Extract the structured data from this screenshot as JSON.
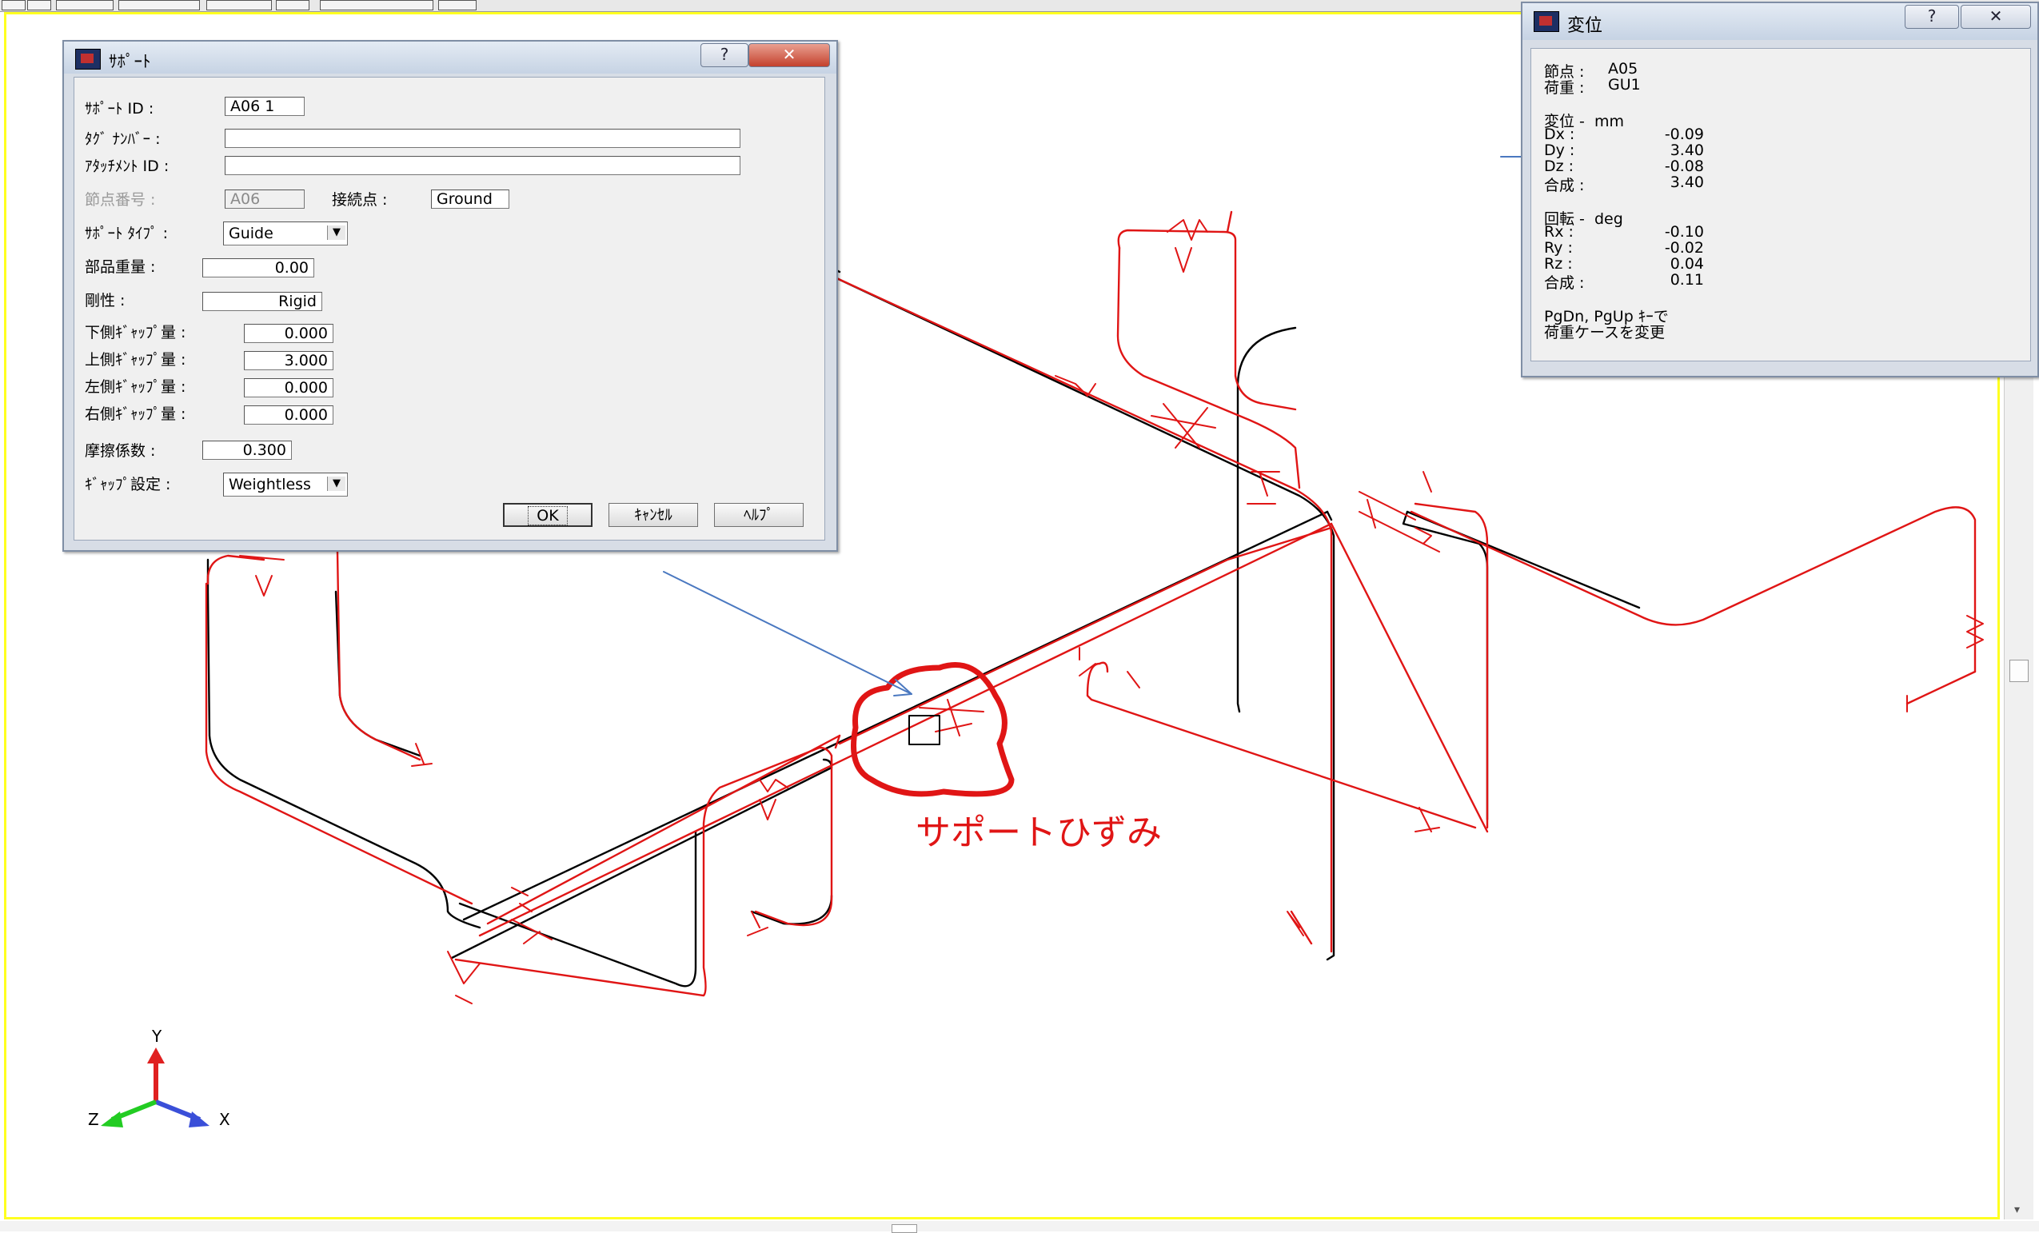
{
  "support_dialog": {
    "title": "ｻﾎﾟｰﾄ",
    "help_glyph": "?",
    "close_glyph": "✕",
    "support_id_label": "ｻﾎﾟｰﾄ ID :",
    "support_id_value": "A06  1",
    "tag_number_label": "ﾀｸﾞ ﾅﾝﾊﾞｰ :",
    "tag_number_value": "",
    "attachment_id_label": "ｱﾀｯﾁﾒﾝﾄ ID :",
    "attachment_id_value": "",
    "node_number_label": "節点番号 :",
    "node_number_value": "A06",
    "connection_point_label": "接続点 :",
    "connection_point_value": "Ground",
    "support_type_label": "ｻﾎﾟｰﾄ ﾀｲﾌﾟ :",
    "support_type_value": "Guide",
    "component_weight_label": "部品重量 :",
    "component_weight_value": "0.00",
    "stiffness_label": "剛性 :",
    "stiffness_value": "Rigid",
    "lower_gap_label": "下側ｷﾞｬｯﾌﾟ量 :",
    "lower_gap_value": "0.000",
    "upper_gap_label": "上側ｷﾞｬｯﾌﾟ量 :",
    "upper_gap_value": "3.000",
    "left_gap_label": "左側ｷﾞｬｯﾌﾟ量 :",
    "left_gap_value": "0.000",
    "right_gap_label": "右側ｷﾞｬｯﾌﾟ量 :",
    "right_gap_value": "0.000",
    "friction_label": "摩擦係数 :",
    "friction_value": "0.300",
    "gap_setting_label": "ｷﾞｬｯﾌﾟ設定 :",
    "gap_setting_value": "Weightless",
    "ok_label": "OK",
    "cancel_label": "ｷｬﾝｾﾙ",
    "help_label": "ﾍﾙﾌﾟ"
  },
  "displacement_window": {
    "title": "変位",
    "help_glyph": "?",
    "close_glyph": "✕",
    "node_label": "節点 :",
    "node_value": "A05",
    "load_label": "荷重 :",
    "load_value": "GU1",
    "displacement_header": "変位 -  mm",
    "dx_label": "Dx :",
    "dx_value": "-0.09",
    "dy_label": "Dy :",
    "dy_value": "3.40",
    "dz_label": "Dz :",
    "dz_value": "-0.08",
    "disp_total_label": "合成 :",
    "disp_total_value": "3.40",
    "rotation_header": "回転 -  deg",
    "rx_label": "Rx :",
    "rx_value": "-0.10",
    "ry_label": "Ry :",
    "ry_value": "-0.02",
    "rz_label": "Rz :",
    "rz_value": "0.04",
    "rot_total_label": "合成 :",
    "rot_total_value": "0.11",
    "hint_line1": "PgDn, PgUp ｷｰで",
    "hint_line2": "荷重ケースを変更"
  },
  "annotation_text": "サポートひずみ",
  "axes": {
    "x": "X",
    "y": "Y",
    "z": "Z"
  },
  "colors": {
    "deformed_pipe": "#e01515",
    "original_pipe": "#000000",
    "viewport_border": "#ffff20",
    "axis_x": "#3a4fd8",
    "axis_y": "#e02020",
    "axis_z": "#22cc22"
  }
}
